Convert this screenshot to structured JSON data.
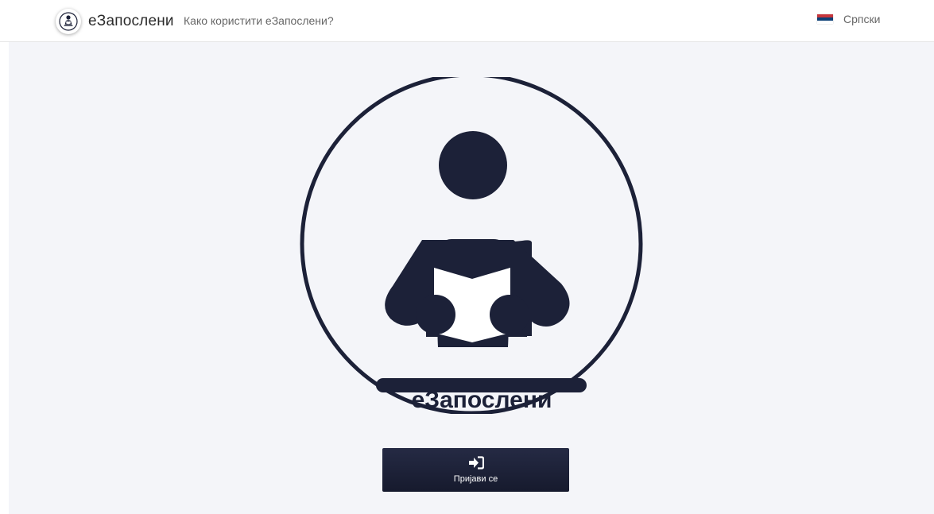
{
  "header": {
    "brand_name": "еЗапослени",
    "help_link": "Како користити еЗапослени?",
    "language": {
      "label": "Српски",
      "flag_icon": "serbia-flag-icon",
      "flag_colors": [
        "#c6363c",
        "#0c4076",
        "#ffffff"
      ]
    }
  },
  "main": {
    "emblem": {
      "icon": "person-reading-icon",
      "caption": "еЗапослени",
      "color": "#1c2138"
    },
    "login_button": {
      "label": "Пријави се",
      "icon": "sign-in-icon"
    }
  },
  "colors": {
    "page_background": "#f4f5f9",
    "accent": "#1c2138"
  }
}
